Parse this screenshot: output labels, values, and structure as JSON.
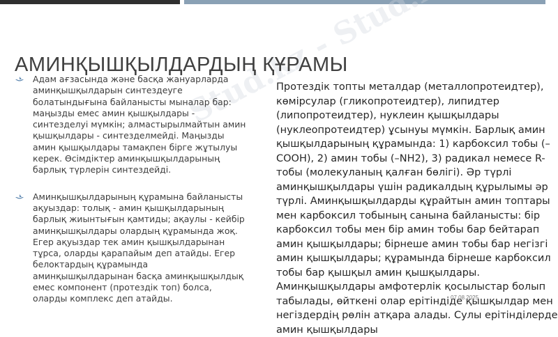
{
  "slide": {
    "title": "АМИНҚЫШҚЫЛДАРДЫҢ ҚҰРАМЫ",
    "bullets": [
      "Адам ағзасында және басқа жануарларда аминқышқылдарын синтездеуге болатындығына байланысты мыналар бар: маңызды емес амин қышқылдары - синтезделуі мүмкін; алмастырылмайтын амин қышқылдары - синтезделмейді. Маңызды амин қышқылдары тамақпен бірге жұтылуы керек. Өсімдіктер аминқышқылдарының барлық түрлерін синтездейді.",
      "Аминқышқылдарының құрамына байланысты ақуыздар: толық - амин қышқылдарының барлық жиынтығын қамтиды; ақаулы - кейбір аминқышқылдары олардың құрамында жоқ. Егер ақуыздар тек амин қышқылдарынан тұрса, оларды қарапайым деп атайды. Егер белоктардың құрамында аминқышқылдарынан басқа аминқышқылдық емес компонент (протездік топ) болса, оларды комплекс деп атайды."
    ],
    "right_text": "Протездік топты металдар (металлопротеидтер), көмірсулар (гликопротеидтер), липидтер (липопротеидтер), нуклеин қышқылдары (нуклеопротеидтер) ұсынуы мүмкін. Барлық амин қышқылдарының құрамында: 1) карбоксил тобы (–COOH), 2) амин тобы (–NH2), 3) радикал немесе R-тобы (молекуланың қалған бөлігі). Әр түрлі аминқышқылдары үшін радикалдың құрылымы әр түрлі. Аминқышқылдарды құрайтын амин топтары мен карбоксил тобының санына байланысты: бір карбоксил тобы мен бір амин тобы бар бейтарап амин қышқылдары; бірнеше амин тобы бар негізгі амин қышқылдары; құрамында бірнеше карбоксил тобы бар қышқыл амин қышқылдары. Аминқышқылдары амфотерлік қосылыстар болып табылады, өйткені олар ерітіндіде қышқылдар мен негіздердің рөлін атқара алады. Сулы ерітінділерде амин қышқылдары",
    "date": "07.08.2025",
    "watermark": "Stud.kz - Stud.kz"
  },
  "colors": {
    "accent": "#8aa1b5",
    "bullet_icon": "#5b86b0"
  },
  "icons": {
    "bullet": "boat-bullet-icon"
  }
}
